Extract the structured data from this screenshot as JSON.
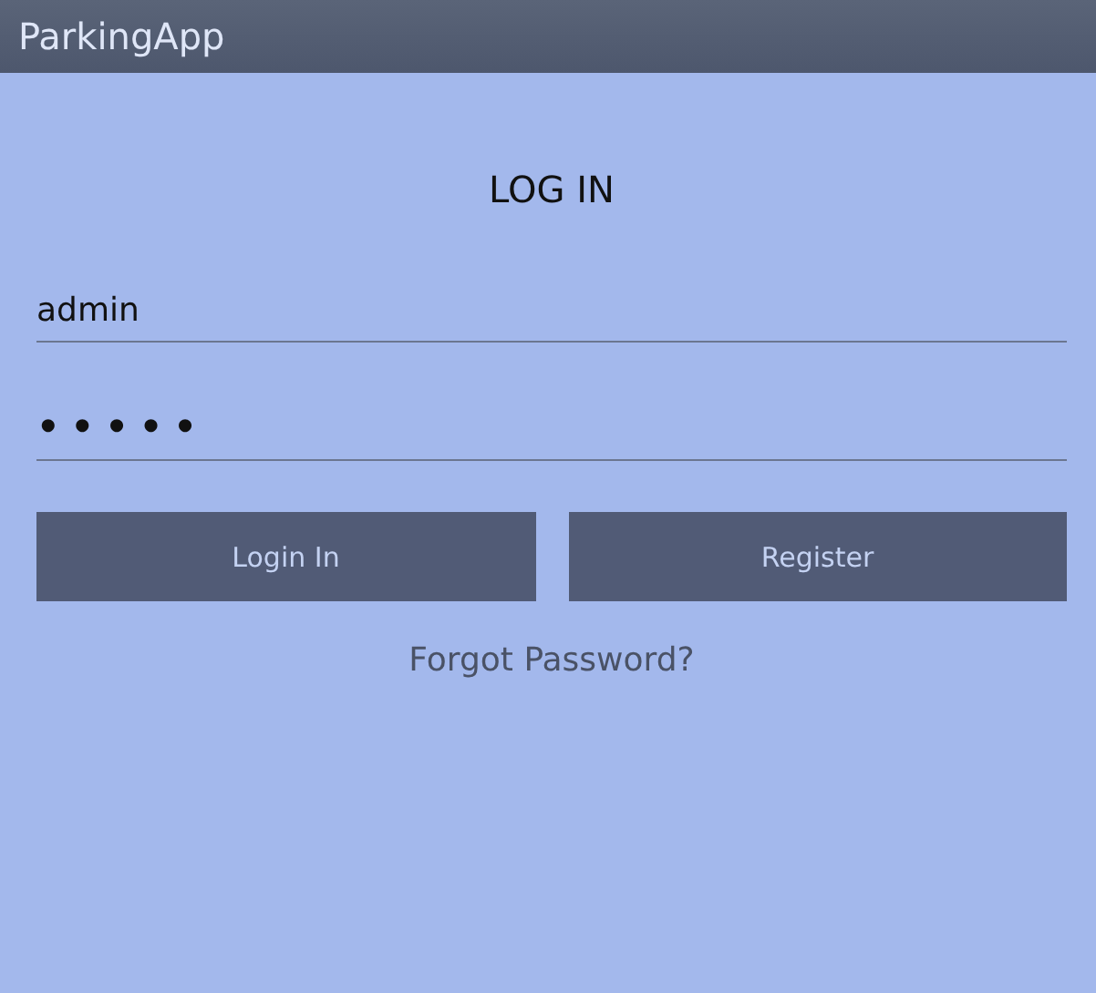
{
  "app_bar": {
    "title": "ParkingApp"
  },
  "heading": "LOG IN",
  "username": {
    "value": "admin"
  },
  "password": {
    "value": "•••••"
  },
  "buttons": [
    {
      "label": "Login In"
    },
    {
      "label": "Register"
    }
  ],
  "link": "Forgot Password?"
}
